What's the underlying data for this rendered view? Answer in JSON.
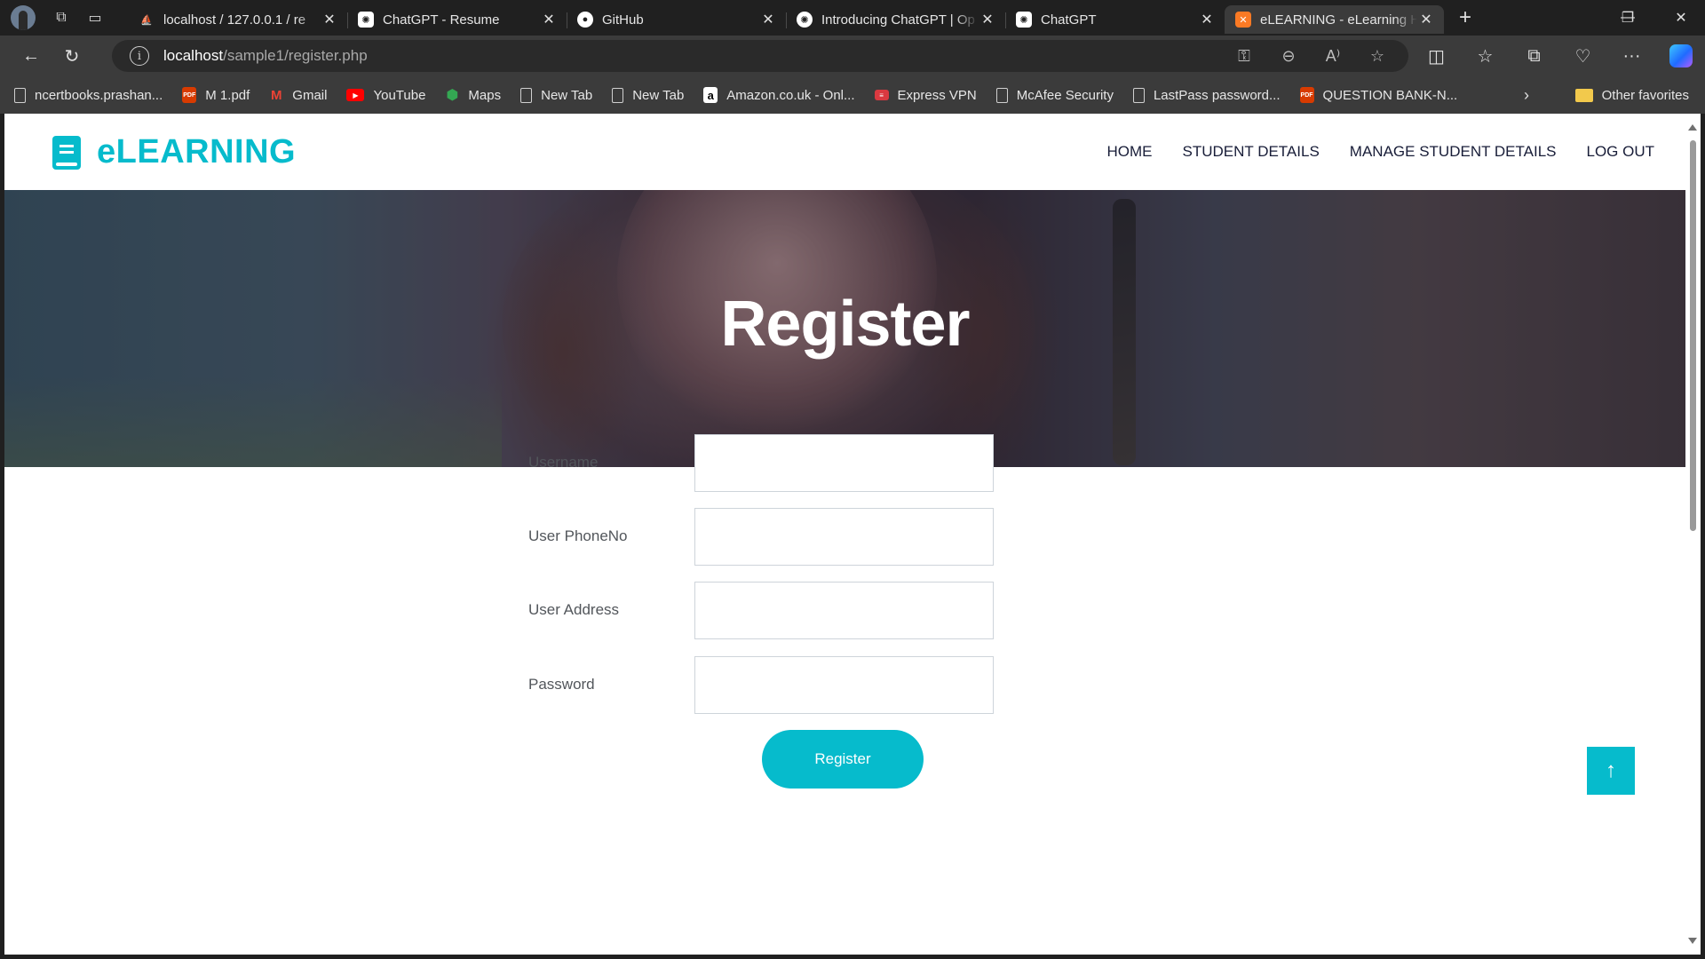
{
  "browser": {
    "tabs": [
      {
        "title": "localhost / 127.0.0.1 / re",
        "favicon": "phpmyadmin-icon",
        "favicon_color": "#f29111",
        "active": false
      },
      {
        "title": "ChatGPT - Resume",
        "favicon": "chatgpt-icon",
        "favicon_color": "#ffffff",
        "active": false
      },
      {
        "title": "GitHub",
        "favicon": "github-icon",
        "favicon_color": "#ffffff",
        "active": false
      },
      {
        "title": "Introducing ChatGPT | Op",
        "favicon": "openai-icon",
        "favicon_color": "#ffffff",
        "active": false
      },
      {
        "title": "ChatGPT",
        "favicon": "chatgpt-icon",
        "favicon_color": "#ffffff",
        "active": false
      },
      {
        "title": "eLEARNING - eLearning H",
        "favicon": "xampp-icon",
        "favicon_color": "#fb7a24",
        "active": true
      }
    ],
    "address": {
      "host": "localhost",
      "path": "/sample1/register.php"
    },
    "bookmarks": [
      {
        "label": "ncertbooks.prashan...",
        "icon": "page-icon"
      },
      {
        "label": "M 1.pdf",
        "icon": "pdf-icon"
      },
      {
        "label": "Gmail",
        "icon": "gmail-icon"
      },
      {
        "label": "YouTube",
        "icon": "youtube-icon"
      },
      {
        "label": "Maps",
        "icon": "maps-icon"
      },
      {
        "label": "New Tab",
        "icon": "page-icon"
      },
      {
        "label": "New Tab",
        "icon": "page-icon"
      },
      {
        "label": "Amazon.co.uk - Onl...",
        "icon": "amazon-icon"
      },
      {
        "label": "Express VPN",
        "icon": "expressvpn-icon"
      },
      {
        "label": "McAfee Security",
        "icon": "page-icon"
      },
      {
        "label": "LastPass password...",
        "icon": "page-icon"
      },
      {
        "label": "QUESTION BANK-N...",
        "icon": "pdf-icon"
      }
    ],
    "other_favorites": "Other favorites"
  },
  "site": {
    "logo_text": "eLEARNING",
    "brand_color": "#06bbcc",
    "nav": [
      "HOME",
      "STUDENT DETAILS",
      "MANAGE STUDENT DETAILS",
      "LOG OUT"
    ],
    "hero_title": "Register",
    "form": {
      "fields": [
        {
          "label": "Username",
          "value": ""
        },
        {
          "label": "User PhoneNo",
          "value": ""
        },
        {
          "label": "User Address",
          "value": ""
        },
        {
          "label": "Password",
          "value": ""
        }
      ],
      "submit_label": "Register"
    },
    "back_to_top_icon": "arrow-up-icon"
  }
}
